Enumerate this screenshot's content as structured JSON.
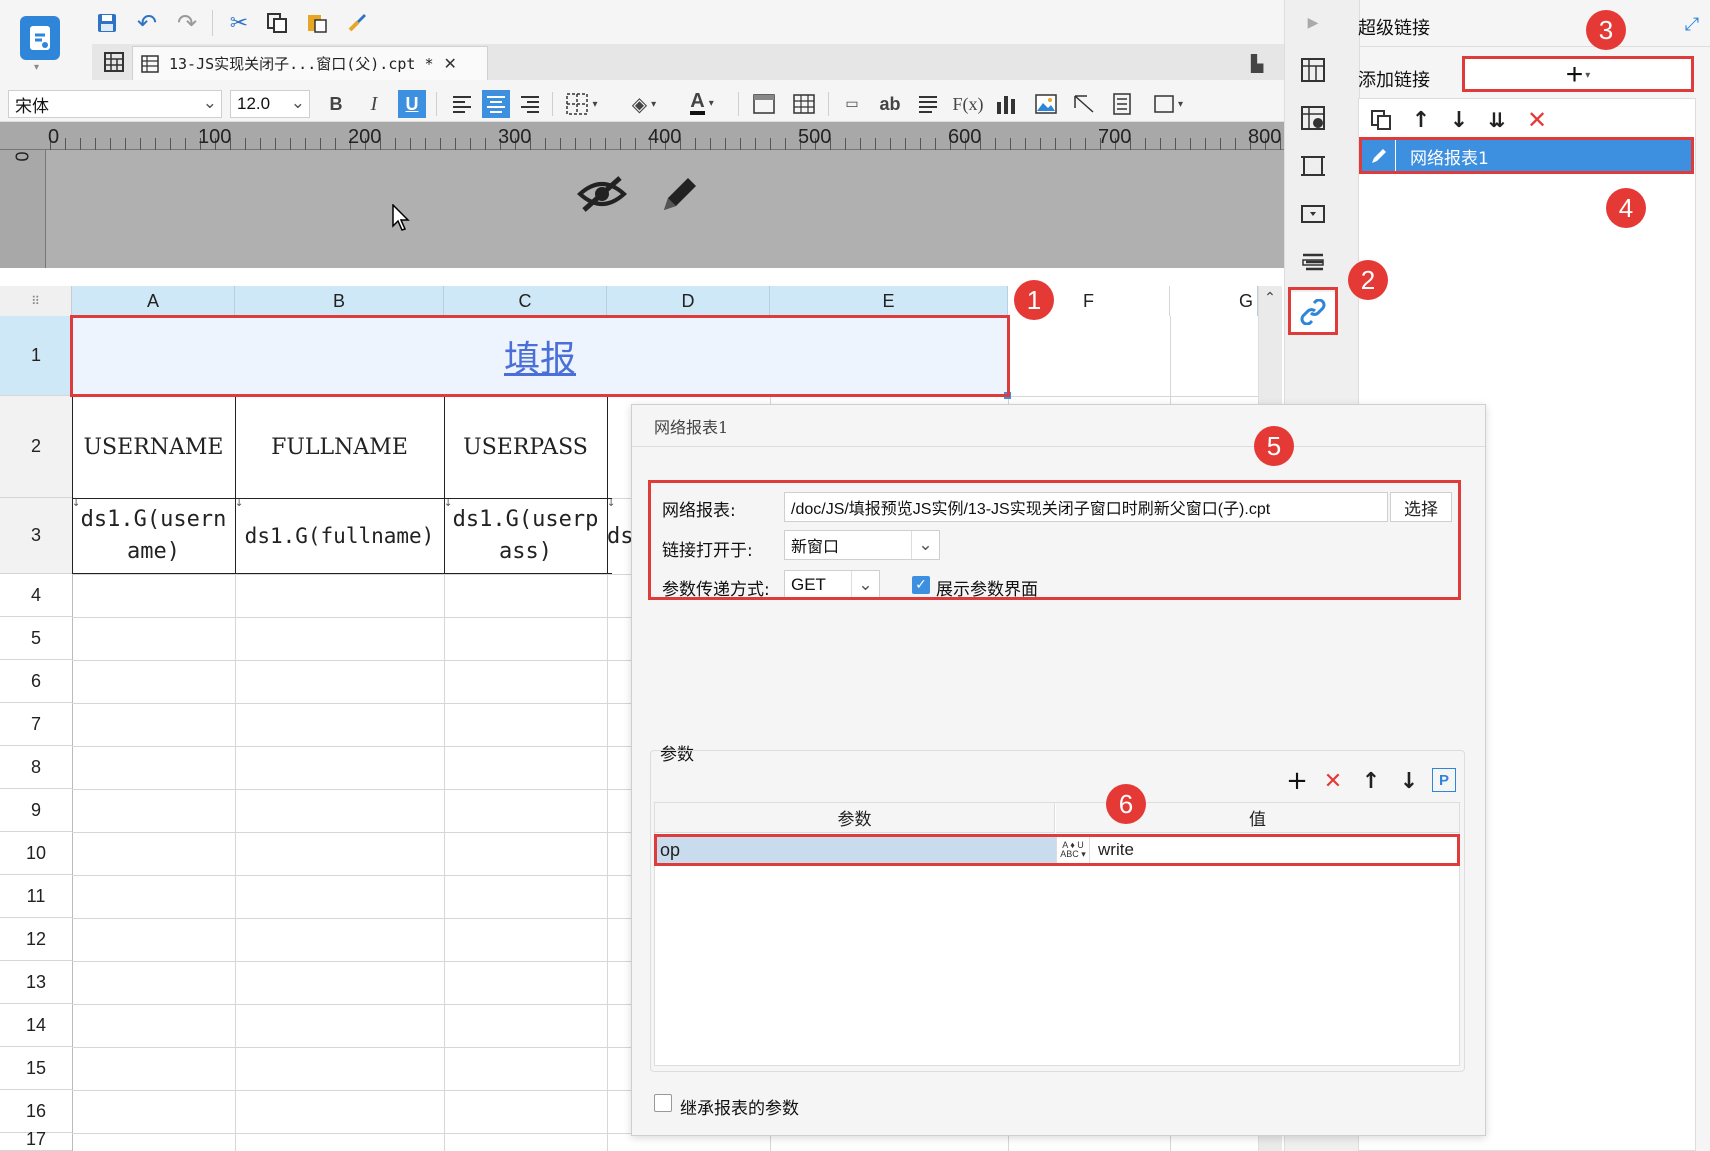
{
  "document_tab": {
    "title": "13-JS实现关闭子...窗口(父).cpt *"
  },
  "format_bar": {
    "font_name": "宋体",
    "font_size": "12.0",
    "bold": "B",
    "italic": "I",
    "underline": "U",
    "ab": "ab",
    "fx": "F(x)"
  },
  "ruler": {
    "marks": [
      "0",
      "100",
      "200",
      "300",
      "400",
      "500",
      "600",
      "700",
      "800"
    ],
    "vertical_zero": "0"
  },
  "grid": {
    "columns": [
      "A",
      "B",
      "C",
      "D",
      "E",
      "F",
      "G"
    ],
    "rows": [
      "1",
      "2",
      "3",
      "4",
      "5",
      "6",
      "7",
      "8",
      "9",
      "10",
      "11",
      "12",
      "13",
      "14",
      "15",
      "16",
      "17"
    ],
    "title_cell": "填报",
    "header_cells": [
      "USERNAME",
      "FULLNAME",
      "USERPASS"
    ],
    "data_cells": [
      "ds1.G(username)",
      "ds1.G(fullname)",
      "ds1.G(userpass)",
      "ds"
    ]
  },
  "right_panel": {
    "title": "超级链接",
    "add_link_label": "添加链接",
    "add_button": "+",
    "links": [
      "网络报表1"
    ]
  },
  "dialog": {
    "title": "网络报表1",
    "report_label": "网络报表:",
    "report_path": "/doc/JS/填报预览JS实例/13-JS实现关闭子窗口时刷新父窗口(子).cpt",
    "choose_button": "选择",
    "open_in_label": "链接打开于:",
    "open_in_value": "新窗口",
    "param_method_label": "参数传递方式:",
    "param_method_value": "GET",
    "show_param_ui_label": "展示参数界面",
    "show_param_ui_checked": true,
    "params_group_label": "参数",
    "params_table": {
      "headers": [
        "参数",
        "值"
      ],
      "rows": [
        {
          "name": "op",
          "value": "write"
        }
      ]
    },
    "inherit_label": "继承报表的参数",
    "inherit_checked": false
  },
  "badges": [
    "1",
    "2",
    "3",
    "4",
    "5",
    "6"
  ],
  "colors": {
    "selection": "#3d8fe0",
    "red": "#e53935",
    "header_bg": "#cfe8f7",
    "link_text": "#4b6fd8"
  }
}
